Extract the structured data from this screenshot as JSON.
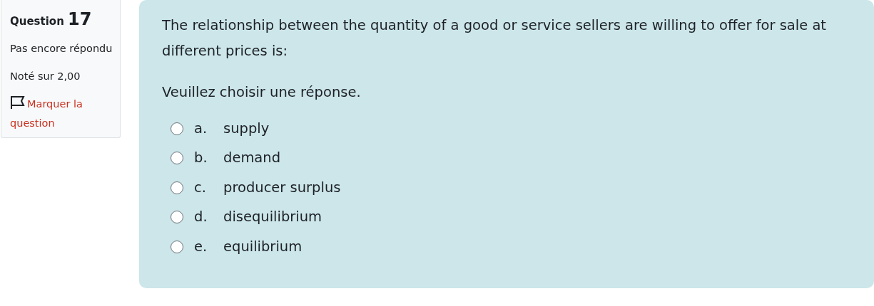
{
  "info": {
    "label": "Question",
    "number": "17",
    "status": "Pas encore répondu",
    "grade": "Noté sur 2,00",
    "flag": {
      "label": "Marquer la question",
      "flagged": false
    }
  },
  "question": {
    "text": "The relationship between the quantity of a good or service sellers are willing to offer for sale at different prices is:",
    "prompt": "Veuillez choisir une réponse.",
    "options": [
      {
        "letter": "a.",
        "text": "supply",
        "selected": false
      },
      {
        "letter": "b.",
        "text": "demand",
        "selected": false
      },
      {
        "letter": "c.",
        "text": "producer surplus",
        "selected": false
      },
      {
        "letter": "d.",
        "text": "disequilibrium",
        "selected": false
      },
      {
        "letter": "e.",
        "text": "equilibrium",
        "selected": false
      }
    ]
  }
}
